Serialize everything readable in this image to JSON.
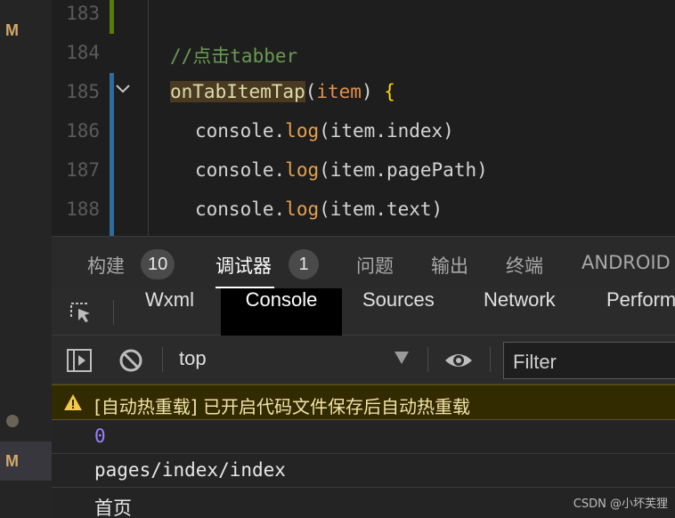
{
  "activity": {
    "modified_marker_1": "M",
    "modified_marker_2": "M"
  },
  "editor": {
    "lines": [
      {
        "num": "183",
        "comment": "",
        "segments": []
      },
      {
        "num": "184",
        "comment": "//点击tabber"
      },
      {
        "num": "185",
        "fn": "onTabItemTap",
        "open_paren": "(",
        "param": "item",
        "close": ") ",
        "brace": "{"
      },
      {
        "num": "186",
        "obj": "console",
        "dot": ".",
        "method": "log",
        "args": "(item.index)"
      },
      {
        "num": "187",
        "obj": "console",
        "dot": ".",
        "method": "log",
        "args": "(item.pagePath)"
      },
      {
        "num": "188",
        "obj": "console",
        "dot": ".",
        "method": "log",
        "args": "(item.text)"
      }
    ]
  },
  "panel_tabs": [
    {
      "label": "构建",
      "badge": "10"
    },
    {
      "label": "调试器",
      "badge": "1"
    },
    {
      "label": "问题"
    },
    {
      "label": "输出"
    },
    {
      "label": "终端"
    },
    {
      "label": "ANDROID"
    }
  ],
  "devtools_tabs": [
    "Wxml",
    "Console",
    "Sources",
    "Network",
    "Perform"
  ],
  "console_toolbar": {
    "context": "top",
    "filter_placeholder": "Filter"
  },
  "console_messages": {
    "warning": "[自动热重载] 已开启代码文件保存后自动热重载",
    "line1": "0",
    "line2": "pages/index/index",
    "line3": "首页"
  },
  "watermark": "CSDN @小坏芙狸",
  "colors": {
    "accent_warning_bg": "#332b00",
    "number_color": "#9980ff",
    "comment_color": "#6a9955"
  }
}
